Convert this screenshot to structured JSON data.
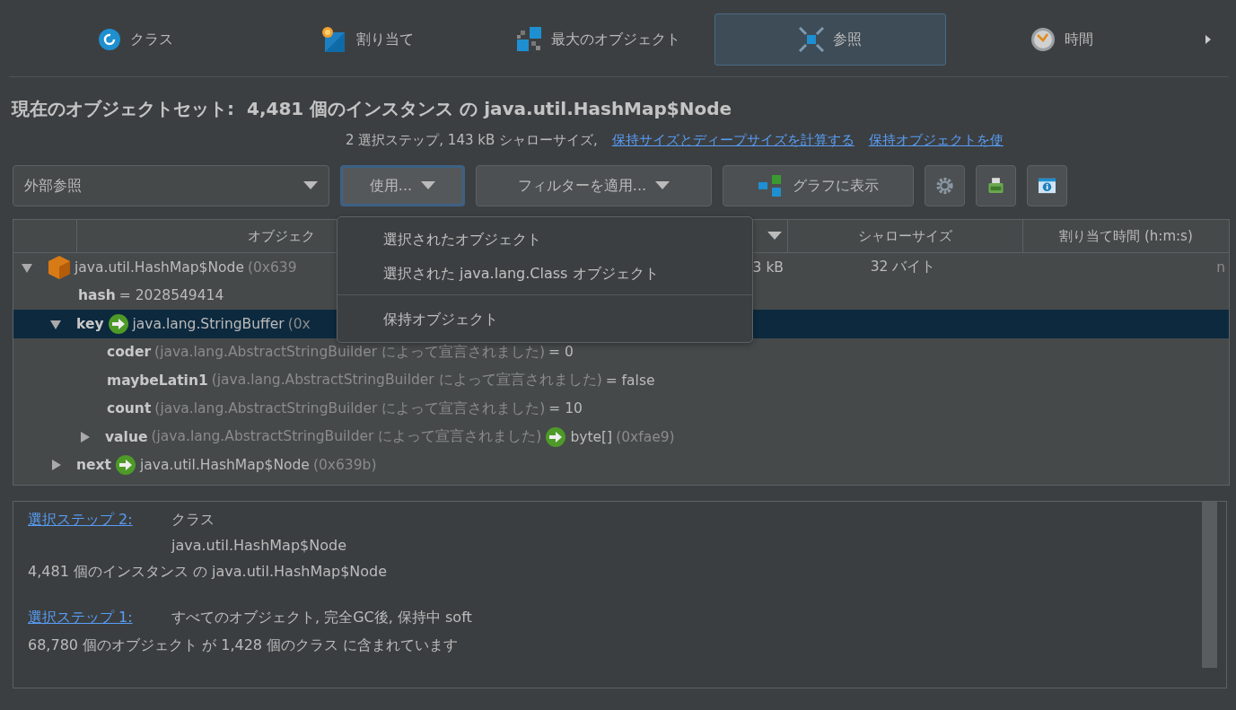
{
  "tabs": [
    {
      "label": "クラス",
      "selected": false
    },
    {
      "label": "割り当て",
      "selected": false
    },
    {
      "label": "最大のオブジェクト",
      "selected": false
    },
    {
      "label": "参照",
      "selected": true
    },
    {
      "label": "時間",
      "selected": false
    }
  ],
  "heading": {
    "label": "現在のオブジェクトセット:",
    "value": "4,481 個のインスタンス の java.util.HashMap$Node"
  },
  "summary": {
    "text": "2 選択ステップ, 143 kB シャローサイズ,",
    "links": [
      "保持サイズとディープサイズを計算する",
      "保持オブジェクトを使"
    ]
  },
  "toolbar": {
    "view": "外部参照",
    "use_button": "使用...",
    "filter_button": "フィルターを適用...",
    "graph_button": "グラフに表示"
  },
  "menu": {
    "sections": [
      {
        "items": [
          "選択されたオブジェクト",
          "選択された java.lang.Class オブジェクト"
        ]
      },
      {
        "items": [
          "保持オブジェクト"
        ]
      }
    ]
  },
  "table": {
    "columns": [
      "",
      "オブジェク",
      "",
      "シャローサイズ",
      "割り当て時間 (h:m:s)"
    ],
    "rows": [
      {
        "kind": "object",
        "type": "java.util.HashMap$Node",
        "address": "(0x639",
        "expanded": true,
        "selected": false,
        "retained": "3 kB",
        "shallow": "32 バイト",
        "alloc": "n",
        "children": [
          {
            "kind": "value",
            "field": "hash",
            "value": "= 2028549414"
          },
          {
            "kind": "ref",
            "field": "key",
            "type": "java.lang.StringBuffer",
            "address": "(0x",
            "expanded": true,
            "selected": true,
            "children": [
              {
                "kind": "value",
                "field": "coder",
                "declared": "(java.lang.AbstractStringBuilder によって宣言されました)",
                "value": "= 0"
              },
              {
                "kind": "value",
                "field": "maybeLatin1",
                "declared": "(java.lang.AbstractStringBuilder によって宣言されました)",
                "value": "= false"
              },
              {
                "kind": "value",
                "field": "count",
                "declared": "(java.lang.AbstractStringBuilder によって宣言されました)",
                "value": "= 10"
              },
              {
                "kind": "ref",
                "field": "value",
                "declared": "(java.lang.AbstractStringBuilder によって宣言されました)",
                "type": "byte[]",
                "address": "(0xfae9)",
                "expanded": false,
                "selected": false
              }
            ]
          },
          {
            "kind": "ref",
            "field": "next",
            "type": "java.util.HashMap$Node",
            "address": "(0x639b)",
            "expanded": false,
            "selected": false
          }
        ]
      }
    ]
  },
  "details": [
    {
      "link": "選択ステップ 2:",
      "lines": [
        "クラス",
        "java.util.HashMap$Node"
      ],
      "result": "4,481 個のインスタンス の java.util.HashMap$Node"
    },
    {
      "link": "選択ステップ 1:",
      "lines": [
        "すべてのオブジェクト, 完全GC後, 保持中 soft"
      ],
      "result": "68,780 個のオブジェクト が 1,428 個のクラス に含まれています"
    }
  ]
}
